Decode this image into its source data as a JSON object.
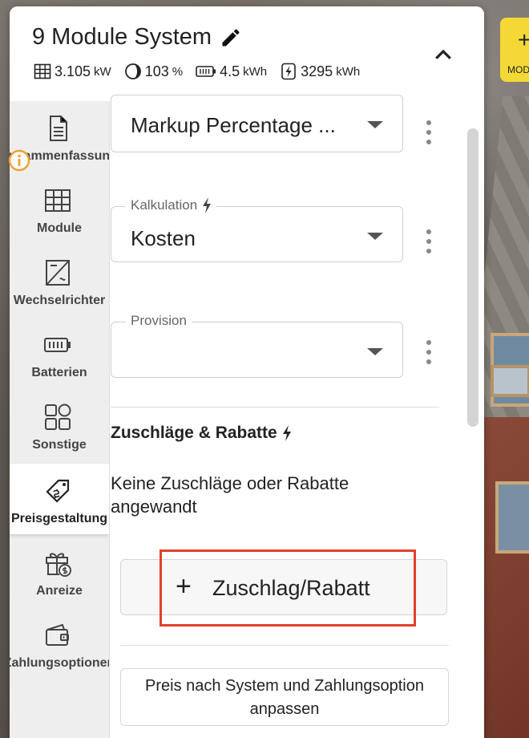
{
  "header": {
    "title": "9 Module System",
    "stats": {
      "power": "3.105",
      "power_unit": "kW",
      "offset": "103",
      "offset_unit": "%",
      "battery": "4.5",
      "battery_unit": "kWh",
      "production": "3295",
      "production_unit": "kWh"
    }
  },
  "map_button": {
    "label": "MOD"
  },
  "sidebar": {
    "items": [
      {
        "label": "Zusammenfassung",
        "icon": "document-icon"
      },
      {
        "label": "Module",
        "icon": "grid-icon"
      },
      {
        "label": "Wechselrichter",
        "icon": "inverter-icon"
      },
      {
        "label": "Batterien",
        "icon": "battery-icon"
      },
      {
        "label": "Sonstige",
        "icon": "shapes-icon"
      },
      {
        "label": "Preisgestaltung",
        "icon": "price-tag-icon",
        "active": true
      },
      {
        "label": "Anreize",
        "icon": "gift-icon"
      },
      {
        "label": "Zahlungsoptionen",
        "icon": "wallet-icon"
      }
    ]
  },
  "fields": {
    "markup": {
      "value": "Markup Percentage ..."
    },
    "kalkulation": {
      "label": "Kalkulation",
      "value": "Kosten"
    },
    "provision": {
      "label": "Provision",
      "value": ""
    }
  },
  "adders": {
    "title": "Zuschläge & Rabatte",
    "empty_text": "Keine Zuschläge oder Rabatte angewandt",
    "add_button": "Zuschlag/Rabatt"
  },
  "adjust_button": "Preis nach System und Zahlungsoption anpassen",
  "colors": {
    "highlight": "#e2402c",
    "accent_yellow": "#f4d936",
    "info_orange": "#f0a030"
  }
}
